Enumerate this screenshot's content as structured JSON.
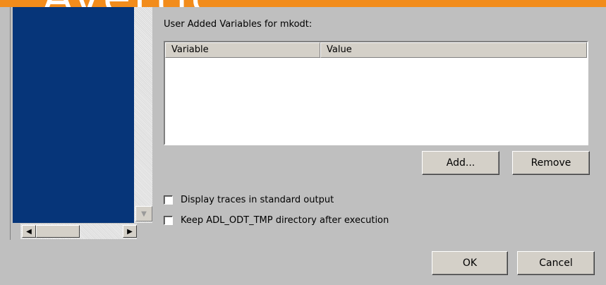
{
  "banner": {
    "text": "Avertic"
  },
  "variables_section": {
    "label": "User Added Variables for mkodt:",
    "columns": [
      "Variable",
      "Value"
    ],
    "rows": []
  },
  "buttons": {
    "add": "Add...",
    "remove": "Remove",
    "ok": "OK",
    "cancel": "Cancel"
  },
  "options": {
    "display_traces": {
      "label": "Display traces in standard output",
      "checked": false
    },
    "keep_tmp_dir": {
      "label": "Keep ADL_ODT_TMP directory after execution",
      "checked": false
    }
  },
  "scrollbars": {
    "left_arrow": "◀",
    "right_arrow": "▶",
    "down_arrow": "▼"
  },
  "colors": {
    "banner": "#f28c1b",
    "panel": "#063579",
    "dialog": "#bfbfbf"
  }
}
